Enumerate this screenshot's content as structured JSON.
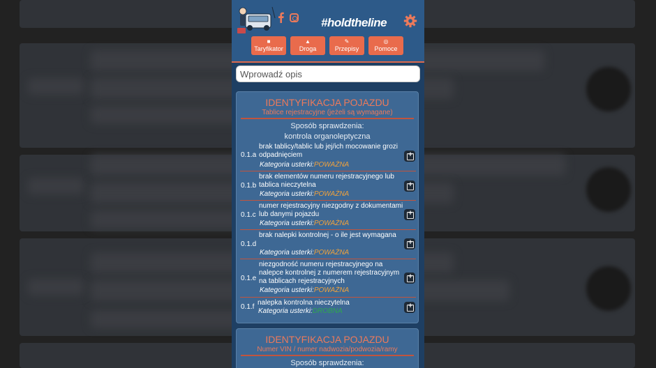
{
  "header": {
    "hashtag": "#holdtheline",
    "social": [
      "facebook-icon",
      "instagram-icon"
    ],
    "settings_icon": "gear-icon"
  },
  "nav": [
    {
      "label": "Taryfikator",
      "icon": "briefcase-icon"
    },
    {
      "label": "Droga",
      "icon": "road-icon"
    },
    {
      "label": "Przepisy",
      "icon": "gavel-icon"
    },
    {
      "label": "Pomoce",
      "icon": "lifebuoy-icon"
    }
  ],
  "search": {
    "placeholder": "Wprowadź opis",
    "value": ""
  },
  "sections": [
    {
      "title": "IDENTYFIKACJA POJAZDU",
      "subtitle": "Tablice rejestracyjne (jeżeli są wymagane)",
      "method_label": "Sposób sprawdzenia:",
      "method_value": "kontrola organoleptyczna",
      "category_prefix": "Kategoria usterki:",
      "items": [
        {
          "code": "0.1.a",
          "desc": "brak tablicy/tablic lub jej/ich mocowanie grozi odpadnięciem",
          "severity": "POWAŻNA"
        },
        {
          "code": "0.1.b",
          "desc": "brak elementów numeru rejestracyjnego lub tablica nieczytelna",
          "severity": "POWAŻNA"
        },
        {
          "code": "0.1.c",
          "desc": "numer rejestracyjny niezgodny z dokumentami lub danymi pojazdu",
          "severity": "POWAŻNA"
        },
        {
          "code": "0.1.d",
          "desc": "brak nalepki kontrolnej - o ile jest wymagana",
          "severity": "POWAŻNA"
        },
        {
          "code": "0.1.e",
          "desc": "niezgodność numeru rejestracyjnego na nalepce kontrolnej z numerem rejestracyjnym na tablicach rejestracyjnych",
          "severity": "POWAŻNA"
        },
        {
          "code": "0.1.f",
          "desc": "nalepka kontrolna nieczytelna",
          "severity": "DROBNA"
        }
      ]
    },
    {
      "title": "IDENTYFIKACJA POJAZDU",
      "subtitle": "Numer VIN / numer nadwozia/podwozia/ramy",
      "method_label": "Sposób sprawdzenia:"
    }
  ],
  "colors": {
    "accent": "#e96b4c",
    "header_bg": "#2d5a89",
    "card_bg": "#3e6894",
    "severe": "#f0a23d",
    "minor": "#2fa84f"
  }
}
